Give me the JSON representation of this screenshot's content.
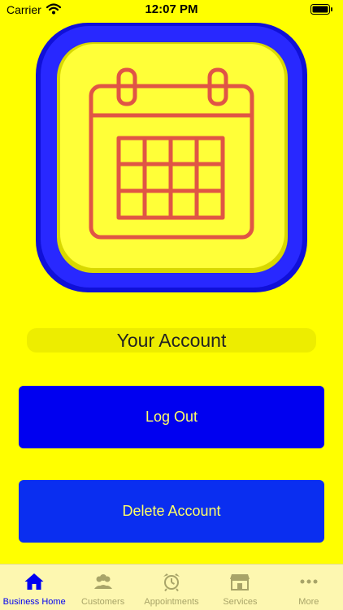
{
  "status_bar": {
    "carrier": "Carrier",
    "time": "12:07 PM"
  },
  "account": {
    "title": "Your Account"
  },
  "buttons": {
    "logout": "Log Out",
    "delete": "Delete Account"
  },
  "tabs": [
    {
      "label": "Business Home",
      "icon": "house-icon",
      "active": true
    },
    {
      "label": "Customers",
      "icon": "people-icon",
      "active": false
    },
    {
      "label": "Appointments",
      "icon": "alarm-clock-icon",
      "active": false
    },
    {
      "label": "Services",
      "icon": "storefront-icon",
      "active": false
    },
    {
      "label": "More",
      "icon": "ellipsis-icon",
      "active": false
    }
  ],
  "colors": {
    "background": "#ffff00",
    "button": "#0000f0",
    "button_text": "#ffff66",
    "active_tab": "#0000f0",
    "logo_border": "#1a1ae6",
    "logo_face": "#ffff33",
    "calendar_stroke": "#e86a5a"
  }
}
